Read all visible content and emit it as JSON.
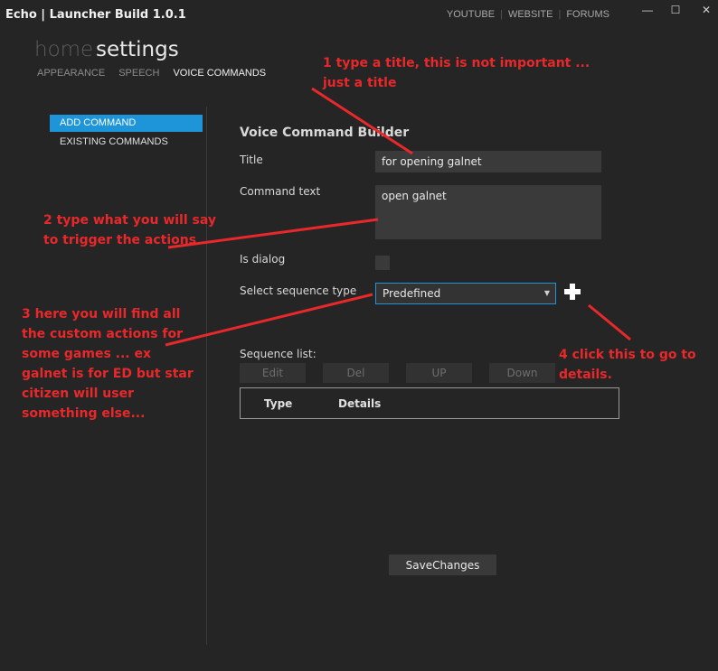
{
  "window": {
    "title": "Echo | Launcher Build 1.0.1",
    "links": [
      "YOUTUBE",
      "WEBSITE",
      "FORUMS"
    ],
    "controls": [
      "—",
      "☐",
      "✕"
    ]
  },
  "nav": {
    "home": "home",
    "settings": "settings",
    "subnav": [
      "APPEARANCE",
      "SPEECH",
      "VOICE COMMANDS"
    ]
  },
  "sidebar": {
    "items": [
      {
        "label": "ADD COMMAND"
      },
      {
        "label": "EXISTING COMMANDS"
      }
    ]
  },
  "builder": {
    "heading": "Voice Command Builder",
    "title_label": "Title",
    "title_value": "for opening galnet",
    "command_label": "Command text",
    "command_value": "open galnet",
    "dialog_label": "Is dialog",
    "seq_type_label": "Select sequence type",
    "seq_type_value": "Predefined",
    "seq_list_label": "Sequence list:",
    "buttons": {
      "edit": "Edit",
      "del": "Del",
      "up": "UP",
      "down": "Down"
    },
    "columns": [
      "Type",
      "Details"
    ],
    "save": "SaveChanges"
  },
  "annotations": {
    "note1": "1 type a title, this is not important ... just a title",
    "note2": "2 type what you will say to trigger the actions",
    "note3": "3 here you will find all the custom actions for some games ... ex galnet is for ED but star citizen will user something else...",
    "note4": "4 click this to go to details.",
    "color": "#e8282a"
  },
  "colors": {
    "background": "#252525",
    "accent": "#1e95d9"
  }
}
